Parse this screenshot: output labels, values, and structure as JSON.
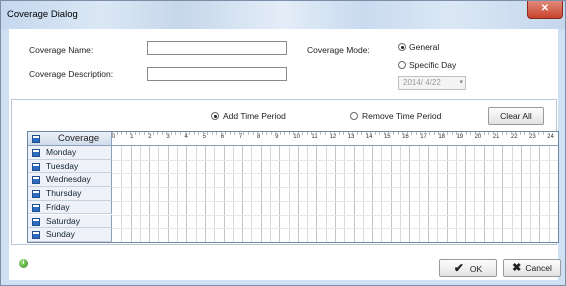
{
  "window": {
    "title": "Coverage Dialog"
  },
  "form": {
    "name_label": "Coverage Name:",
    "name_value": "",
    "description_label": "Coverage Description:",
    "description_value": "",
    "mode_label": "Coverage Mode:",
    "mode_options": [
      "General",
      "Specific Day"
    ],
    "mode_selected": "General",
    "date_value": "2014/  4/22"
  },
  "toolbar": {
    "add_label": "Add Time Period",
    "remove_label": "Remove Time Period",
    "period_selected": "Add Time Period",
    "clear_label": "Clear All"
  },
  "grid": {
    "header_label": "Coverage",
    "hours": [
      "0",
      "1",
      "2",
      "3",
      "4",
      "5",
      "6",
      "7",
      "8",
      "9",
      "10",
      "11",
      "12",
      "13",
      "14",
      "15",
      "16",
      "17",
      "18",
      "19",
      "20",
      "21",
      "22",
      "23",
      "24"
    ],
    "days": [
      "Monday",
      "Tuesday",
      "Wednesday",
      "Thursday",
      "Friday",
      "Saturday",
      "Sunday"
    ]
  },
  "footer": {
    "ok_label": "OK",
    "cancel_label": "Cancel"
  },
  "icons": {
    "info": "info-icon",
    "ok": "check-icon",
    "cancel": "x-icon",
    "day": "calendar-icon",
    "close": "close-icon"
  }
}
